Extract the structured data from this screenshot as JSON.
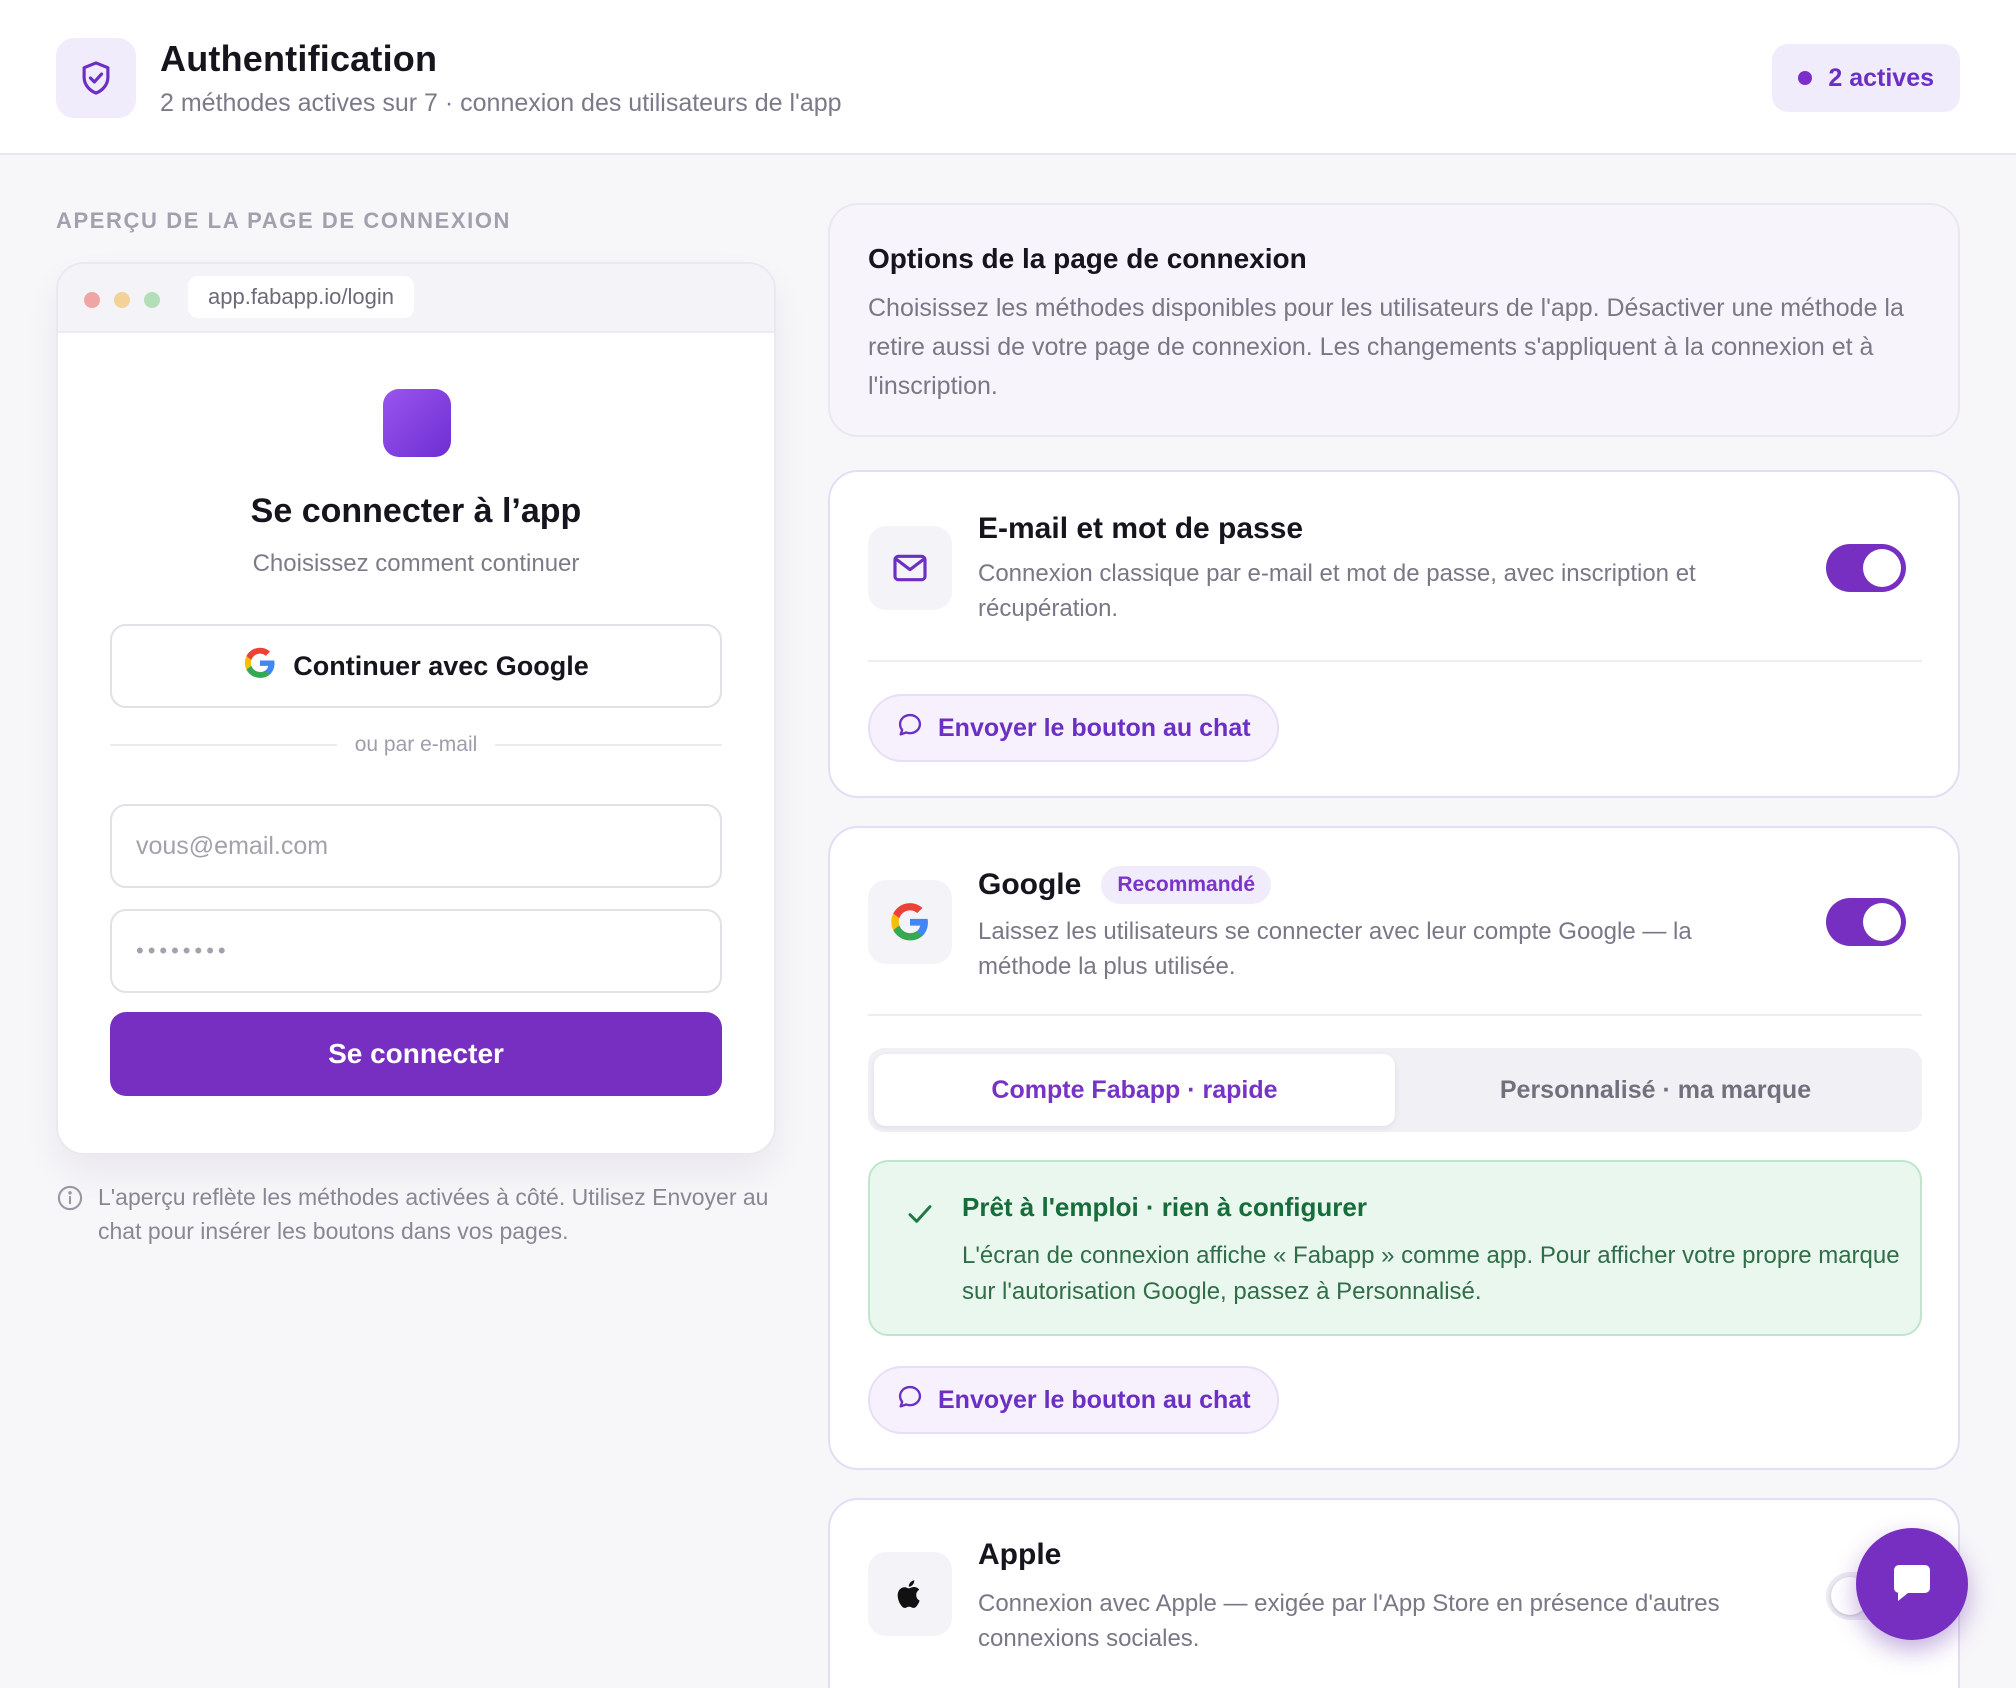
{
  "header": {
    "title": "Authentification",
    "subtitle": "2 méthodes actives sur 7 · connexion des utilisateurs de l'app",
    "status_badge": "2 actives"
  },
  "preview": {
    "section_label": "APERÇU DE LA PAGE DE CONNEXION",
    "url": "app.fabapp.io/login",
    "login_title": "Se connecter à l’app",
    "login_subtitle": "Choisissez comment continuer",
    "google_button": "Continuer avec Google",
    "divider": "ou par e-mail",
    "email_placeholder": "vous@email.com",
    "password_mask": "••••••••",
    "signin_button": "Se connecter",
    "note": "L'aperçu reflète les méthodes activées à côté. Utilisez Envoyer au chat pour insérer les boutons dans vos pages."
  },
  "options": {
    "title": "Options de la page de connexion",
    "description": "Choisissez les méthodes disponibles pour les utilisateurs de l'app. Désactiver une méthode la retire aussi de votre page de connexion. Les changements s'appliquent à la connexion et à l'inscription."
  },
  "methods": {
    "email": {
      "icon": "mail-icon",
      "title": "E-mail et mot de passe",
      "description": "Connexion classique par e-mail et mot de passe, avec inscription et récupération.",
      "enabled": true,
      "chat_button": "Envoyer le bouton au chat"
    },
    "google": {
      "icon": "google-icon",
      "title": "Google",
      "badge": "Recommandé",
      "description": "Laissez les utilisateurs se connecter avec leur compte Google — la méthode la plus utilisée.",
      "enabled": true,
      "segments": [
        "Compte Fabapp · rapide",
        "Personnalisé · ma marque"
      ],
      "selected_segment": "Compte Fabapp · rapide",
      "ready_title": "Prêt à l'emploi · rien à configurer",
      "ready_text": "L'écran de connexion affiche « Fabapp » comme app. Pour afficher votre propre marque sur l'autorisation Google, passez à Personnalisé.",
      "chat_button": "Envoyer le bouton au chat"
    },
    "apple": {
      "icon": "apple-icon",
      "title": "Apple",
      "description": "Connexion avec Apple — exigée par l'App Store en présence d'autres connexions sociales.",
      "enabled": false
    }
  },
  "colors": {
    "accent": "#772fc2",
    "accent_soft": "#f1ecfb",
    "success": "#166c3a",
    "success_bg": "#eaf7ef"
  }
}
